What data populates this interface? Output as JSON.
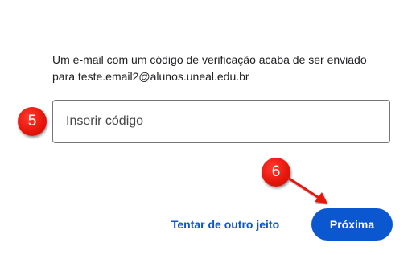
{
  "verification": {
    "message_line1": "Um e-mail com um código de verificação acaba de ser enviado",
    "message_line2": "para teste.email2@alunos.uneal.edu.br"
  },
  "code_input": {
    "placeholder": "Inserir código",
    "value": ""
  },
  "annotations": {
    "step_code": "5",
    "step_next": "6",
    "marker_color": "#e8160c"
  },
  "actions": {
    "try_another_way_label": "Tentar de outro jeito",
    "next_label": "Próxima",
    "accent_color": "#0b57d0"
  }
}
